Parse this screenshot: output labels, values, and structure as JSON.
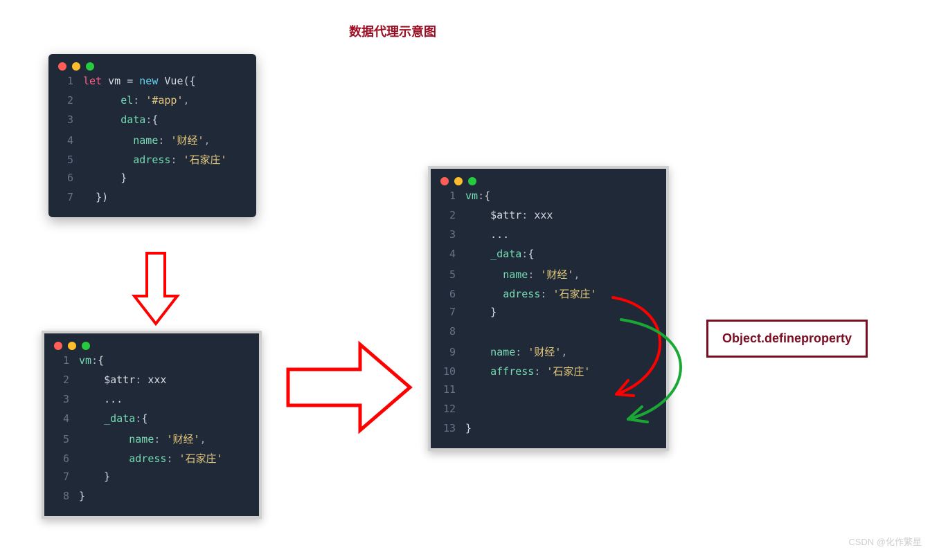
{
  "title": "数据代理示意图",
  "label_text": "Object.defineproperty",
  "watermark": "CSDN @化作繁星",
  "code1_lines": [
    {
      "n": "1",
      "tokens": [
        {
          "c": "kw-let",
          "t": "let "
        },
        {
          "c": "ident",
          "t": "vm "
        },
        {
          "c": "punc",
          "t": "= "
        },
        {
          "c": "kw-new",
          "t": "new "
        },
        {
          "c": "class-nm",
          "t": "Vue"
        },
        {
          "c": "punc",
          "t": "({"
        }
      ]
    },
    {
      "n": "2",
      "indent": 6,
      "tokens": [
        {
          "c": "prop",
          "t": "el"
        },
        {
          "c": "colon",
          "t": ": "
        },
        {
          "c": "str",
          "t": "'#app'"
        },
        {
          "c": "punc-dim",
          "t": ","
        }
      ]
    },
    {
      "n": "3",
      "indent": 6,
      "tokens": [
        {
          "c": "prop",
          "t": "data"
        },
        {
          "c": "colon",
          "t": ":"
        },
        {
          "c": "punc",
          "t": "{"
        }
      ]
    },
    {
      "n": "4",
      "indent": 8,
      "tokens": [
        {
          "c": "prop",
          "t": "name"
        },
        {
          "c": "colon",
          "t": ": "
        },
        {
          "c": "str",
          "t": "'财经'"
        },
        {
          "c": "punc-dim",
          "t": ","
        }
      ]
    },
    {
      "n": "5",
      "indent": 8,
      "tokens": [
        {
          "c": "prop",
          "t": "adress"
        },
        {
          "c": "colon",
          "t": ": "
        },
        {
          "c": "str",
          "t": "'石家庄'"
        }
      ]
    },
    {
      "n": "6",
      "indent": 6,
      "tokens": [
        {
          "c": "punc",
          "t": "}"
        }
      ]
    },
    {
      "n": "7",
      "indent": 2,
      "tokens": [
        {
          "c": "punc",
          "t": "})"
        }
      ]
    }
  ],
  "code2_lines": [
    {
      "n": "1",
      "tokens": [
        {
          "c": "prop",
          "t": "vm"
        },
        {
          "c": "colon",
          "t": ":"
        },
        {
          "c": "punc",
          "t": "{"
        }
      ]
    },
    {
      "n": "2",
      "indent": 4,
      "tokens": [
        {
          "c": "ident",
          "t": "$attr"
        },
        {
          "c": "colon",
          "t": ": "
        },
        {
          "c": "ident",
          "t": "xxx"
        }
      ]
    },
    {
      "n": "3",
      "indent": 4,
      "tokens": [
        {
          "c": "punc",
          "t": "..."
        }
      ]
    },
    {
      "n": "4",
      "indent": 4,
      "tokens": [
        {
          "c": "prop",
          "t": "_data"
        },
        {
          "c": "colon",
          "t": ":"
        },
        {
          "c": "punc",
          "t": "{"
        }
      ]
    },
    {
      "n": "5",
      "indent": 8,
      "tokens": [
        {
          "c": "prop",
          "t": "name"
        },
        {
          "c": "colon",
          "t": ": "
        },
        {
          "c": "str",
          "t": "'财经'"
        },
        {
          "c": "punc-dim",
          "t": ","
        }
      ]
    },
    {
      "n": "6",
      "indent": 8,
      "tokens": [
        {
          "c": "prop",
          "t": "adress"
        },
        {
          "c": "colon",
          "t": ": "
        },
        {
          "c": "str",
          "t": "'石家庄'"
        }
      ]
    },
    {
      "n": "7",
      "indent": 4,
      "tokens": [
        {
          "c": "punc",
          "t": "}"
        }
      ]
    },
    {
      "n": "8",
      "indent": 0,
      "tokens": [
        {
          "c": "punc",
          "t": "}"
        }
      ]
    }
  ],
  "code3_lines": [
    {
      "n": "1",
      "tokens": [
        {
          "c": "prop",
          "t": "vm"
        },
        {
          "c": "colon",
          "t": ":"
        },
        {
          "c": "punc",
          "t": "{"
        }
      ]
    },
    {
      "n": "2",
      "indent": 4,
      "tokens": [
        {
          "c": "ident",
          "t": "$attr"
        },
        {
          "c": "colon",
          "t": ": "
        },
        {
          "c": "ident",
          "t": "xxx"
        }
      ]
    },
    {
      "n": "3",
      "indent": 4,
      "tokens": [
        {
          "c": "punc",
          "t": "..."
        }
      ]
    },
    {
      "n": "4",
      "indent": 4,
      "tokens": [
        {
          "c": "prop",
          "t": "_data"
        },
        {
          "c": "colon",
          "t": ":"
        },
        {
          "c": "punc",
          "t": "{"
        }
      ]
    },
    {
      "n": "5",
      "indent": 6,
      "tokens": [
        {
          "c": "prop",
          "t": "name"
        },
        {
          "c": "colon",
          "t": ": "
        },
        {
          "c": "str",
          "t": "'财经'"
        },
        {
          "c": "punc-dim",
          "t": ","
        }
      ]
    },
    {
      "n": "6",
      "indent": 6,
      "tokens": [
        {
          "c": "prop",
          "t": "adress"
        },
        {
          "c": "colon",
          "t": ": "
        },
        {
          "c": "str",
          "t": "'石家庄'"
        }
      ]
    },
    {
      "n": "7",
      "indent": 4,
      "tokens": [
        {
          "c": "punc",
          "t": "}"
        }
      ]
    },
    {
      "n": "8",
      "tokens": []
    },
    {
      "n": "9",
      "indent": 4,
      "tokens": [
        {
          "c": "prop",
          "t": "name"
        },
        {
          "c": "colon",
          "t": ": "
        },
        {
          "c": "str",
          "t": "'财经'"
        },
        {
          "c": "punc-dim",
          "t": ","
        }
      ]
    },
    {
      "n": "10",
      "indent": 4,
      "tokens": [
        {
          "c": "prop",
          "t": "affress"
        },
        {
          "c": "colon",
          "t": ": "
        },
        {
          "c": "str",
          "t": "'石家庄'"
        }
      ]
    },
    {
      "n": "11",
      "tokens": []
    },
    {
      "n": "12",
      "tokens": []
    },
    {
      "n": "13",
      "indent": 0,
      "tokens": [
        {
          "c": "punc",
          "t": "}"
        }
      ]
    }
  ],
  "colors": {
    "title": "#9b0d22",
    "arrow": "#ff0000",
    "green_arrow": "#1aa835",
    "window_bg": "#1f2937"
  }
}
